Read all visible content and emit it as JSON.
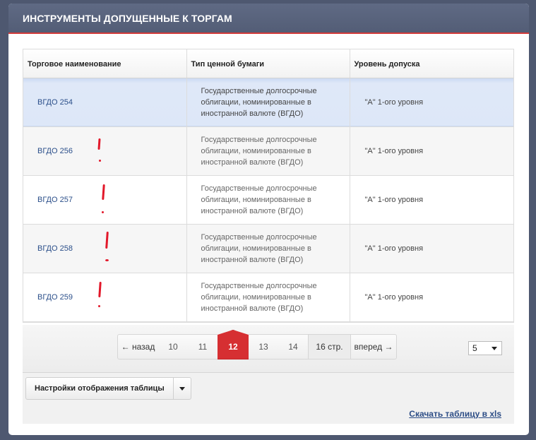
{
  "header": {
    "title": "ИНСТРУМЕНТЫ ДОПУЩЕННЫЕ К ТОРГАМ"
  },
  "table": {
    "columns": [
      "Торговое наименование",
      "Тип ценной бумаги",
      "Уровень допуска"
    ],
    "rows": [
      {
        "name": "ВГДО 254",
        "type": "Государственные долгосрочные облигации, номинированные в иностранной валюте (ВГДО)",
        "level": "\"А\" 1-ого уровня"
      },
      {
        "name": "ВГДО 256",
        "type": "Государственные долгосрочные облигации, номинированные в иностранной валюте (ВГДО)",
        "level": "\"А\" 1-ого уровня"
      },
      {
        "name": "ВГДО 257",
        "type": "Государственные долгосрочные облигации, номинированные в иностранной валюте (ВГДО)",
        "level": "\"А\" 1-ого уровня"
      },
      {
        "name": "ВГДО 258",
        "type": "Государственные долгосрочные облигации, номинированные в иностранной валюте (ВГДО)",
        "level": "\"А\" 1-ого уровня"
      },
      {
        "name": "ВГДО 259",
        "type": "Государственные долгосрочные облигации, номинированные в иностранной валюте (ВГДО)",
        "level": "\"А\" 1-ого уровня"
      }
    ],
    "selected_row": "ВГДО 254"
  },
  "pager": {
    "prev": "← назад",
    "pages": [
      "10",
      "11",
      "12",
      "13",
      "14"
    ],
    "current": "12",
    "total": "16 стр.",
    "next": "вперед →",
    "page_size": "5"
  },
  "footer": {
    "settings_label": "Настройки отображения таблицы",
    "download_link": "Скачать таблицу в xls"
  },
  "colors": {
    "header_bg": "#59637c",
    "accent_red": "#d62f32",
    "link_blue": "#2b4f8a",
    "selected_row": "#dde7f8",
    "annotation_red": "#e2182a"
  }
}
